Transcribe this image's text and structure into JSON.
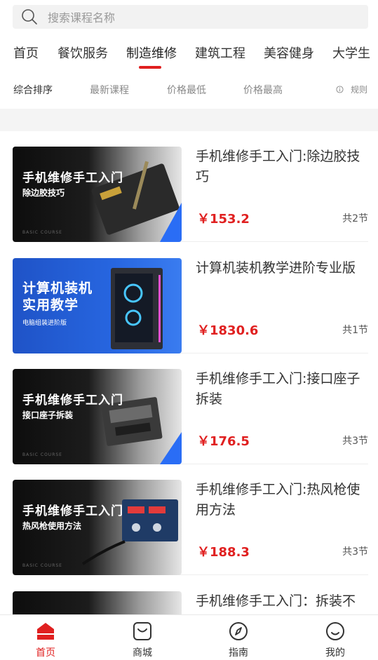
{
  "search": {
    "placeholder": "搜索课程名称"
  },
  "tabs": [
    {
      "label": "首页",
      "active": false
    },
    {
      "label": "餐饮服务",
      "active": false
    },
    {
      "label": "制造维修",
      "active": true
    },
    {
      "label": "建筑工程",
      "active": false
    },
    {
      "label": "美容健身",
      "active": false
    },
    {
      "label": "大学生",
      "active": false
    }
  ],
  "sorts": [
    {
      "label": "综合排序",
      "active": true
    },
    {
      "label": "最新课程",
      "active": false
    },
    {
      "label": "价格最低",
      "active": false
    },
    {
      "label": "价格最高",
      "active": false
    }
  ],
  "rule_label": "规则",
  "courses": [
    {
      "title": "手机维修手工入门:除边胶技巧",
      "price": "￥153.2",
      "lessons": "共2节",
      "thumb": {
        "title": "手机维修手工入门",
        "subtitle": "除边胶技巧",
        "small": "BASIC COURSE",
        "style": "dark"
      }
    },
    {
      "title": "计算机装机教学进阶专业版",
      "price": "￥1830.6",
      "lessons": "共1节",
      "thumb": {
        "title": "计算机装机",
        "title2": "实用教学",
        "subtitle": "电脑组装进阶版",
        "style": "blue"
      }
    },
    {
      "title": "手机维修手工入门:接口座子拆装",
      "price": "￥176.5",
      "lessons": "共3节",
      "thumb": {
        "title": "手机维修手工入门",
        "subtitle": "接口座子拆装",
        "small": "BASIC COURSE",
        "style": "dark"
      }
    },
    {
      "title": "手机维修手工入门:热风枪使用方法",
      "price": "￥188.3",
      "lessons": "共3节",
      "thumb": {
        "title": "手机维修手工入门",
        "subtitle": "热风枪使用方法",
        "small": "BASIC COURSE",
        "style": "dark"
      }
    },
    {
      "title": "手机维修手工入门：拆装不",
      "price": "",
      "lessons": "",
      "thumb": {
        "title": "",
        "subtitle": "",
        "style": "dark"
      }
    }
  ],
  "bottom_nav": [
    {
      "label": "首页",
      "icon": "home-icon",
      "active": true
    },
    {
      "label": "商城",
      "icon": "shop-icon",
      "active": false
    },
    {
      "label": "指南",
      "icon": "compass-icon",
      "active": false
    },
    {
      "label": "我的",
      "icon": "profile-icon",
      "active": false
    }
  ],
  "colors": {
    "accent": "#e02020",
    "text": "#333333",
    "muted": "#888888",
    "thumb_blue": "#1f53c7"
  }
}
